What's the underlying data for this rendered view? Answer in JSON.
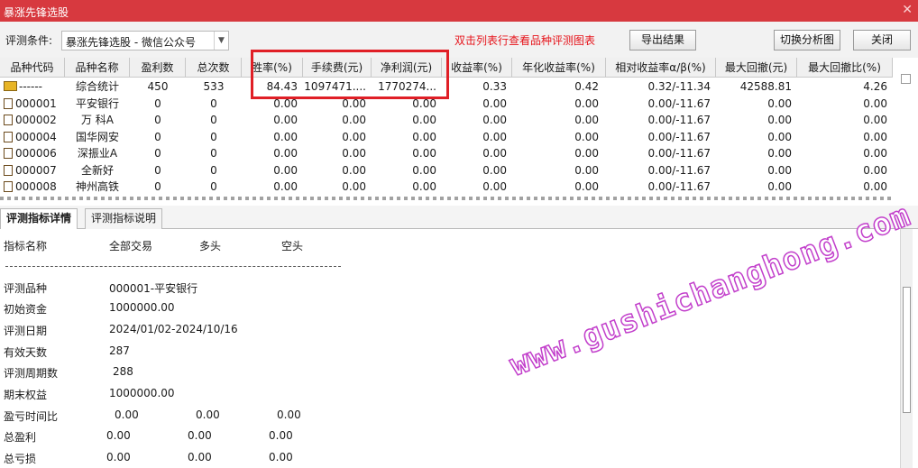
{
  "window": {
    "title": "暴涨先锋选股",
    "close_glyph": "✕"
  },
  "toolbar": {
    "condition_label": "评测条件:",
    "condition_value": "暴涨先锋选股  -  微信公众号",
    "hint": "双击列表行查看品种评测图表",
    "export_button": "导出结果",
    "switch_button": "切换分析图",
    "close_button": "关闭"
  },
  "grid": {
    "columns": [
      "品种代码",
      "品种名称",
      "盈利数",
      "总次数",
      "胜率(%)",
      "手续费(元)",
      "净利润(元)",
      "收益率(%)",
      "年化收益率(%)",
      "相对收益率α/β(%)",
      "最大回撤(元)",
      "最大回撤比(%)"
    ],
    "summary_row": {
      "code": "------",
      "name": "综合统计",
      "wins": "450",
      "total": "533",
      "win_rate": "84.43",
      "fee": "1097471....",
      "net_profit": "1770274...",
      "return": "0.33",
      "annual_return": "0.42",
      "relative": "0.32/-11.34",
      "max_dd": "42588.81",
      "max_dd_ratio": "4.26"
    },
    "rows": [
      {
        "code": "000001",
        "name": "平安银行",
        "wins": "0",
        "total": "0",
        "win_rate": "0.00",
        "fee": "0.00",
        "net_profit": "0.00",
        "return": "0.00",
        "annual_return": "0.00",
        "relative": "0.00/-11.67",
        "max_dd": "0.00",
        "max_dd_ratio": "0.00"
      },
      {
        "code": "000002",
        "name": "万 科A",
        "wins": "0",
        "total": "0",
        "win_rate": "0.00",
        "fee": "0.00",
        "net_profit": "0.00",
        "return": "0.00",
        "annual_return": "0.00",
        "relative": "0.00/-11.67",
        "max_dd": "0.00",
        "max_dd_ratio": "0.00"
      },
      {
        "code": "000004",
        "name": "国华网安",
        "wins": "0",
        "total": "0",
        "win_rate": "0.00",
        "fee": "0.00",
        "net_profit": "0.00",
        "return": "0.00",
        "annual_return": "0.00",
        "relative": "0.00/-11.67",
        "max_dd": "0.00",
        "max_dd_ratio": "0.00"
      },
      {
        "code": "000006",
        "name": "深振业A",
        "wins": "0",
        "total": "0",
        "win_rate": "0.00",
        "fee": "0.00",
        "net_profit": "0.00",
        "return": "0.00",
        "annual_return": "0.00",
        "relative": "0.00/-11.67",
        "max_dd": "0.00",
        "max_dd_ratio": "0.00"
      },
      {
        "code": "000007",
        "name": "全新好",
        "wins": "0",
        "total": "0",
        "win_rate": "0.00",
        "fee": "0.00",
        "net_profit": "0.00",
        "return": "0.00",
        "annual_return": "0.00",
        "relative": "0.00/-11.67",
        "max_dd": "0.00",
        "max_dd_ratio": "0.00"
      },
      {
        "code": "000008",
        "name": "神州高铁",
        "wins": "0",
        "total": "0",
        "win_rate": "0.00",
        "fee": "0.00",
        "net_profit": "0.00",
        "return": "0.00",
        "annual_return": "0.00",
        "relative": "0.00/-11.67",
        "max_dd": "0.00",
        "max_dd_ratio": "0.00"
      }
    ]
  },
  "tabs": [
    "评测指标详情",
    "评测指标说明"
  ],
  "detail": {
    "headers": [
      "指标名称",
      "全部交易",
      "多头",
      "空头"
    ],
    "items": [
      {
        "label": "评测品种",
        "values": [
          "000001-平安银行"
        ]
      },
      {
        "label": "初始资金",
        "values": [
          "1000000.00"
        ]
      },
      {
        "label": "评测日期",
        "values": [
          "2024/01/02-2024/10/16"
        ]
      },
      {
        "label": "有效天数",
        "values": [
          "287"
        ]
      },
      {
        "label": "评测周期数",
        "values": [
          "288"
        ]
      },
      {
        "label": "期末权益",
        "values": [
          "1000000.00"
        ]
      },
      {
        "label": "盈亏时间比",
        "values": [
          "0.00",
          "0.00",
          "0.00"
        ]
      },
      {
        "label": "总盈利",
        "values": [
          "0.00",
          "0.00",
          "0.00"
        ]
      },
      {
        "label": "总亏损",
        "values": [
          "0.00",
          "0.00",
          "0.00"
        ]
      }
    ]
  },
  "watermark": "www.gushichanghong.com",
  "colors": {
    "titlebar": "#d7393f",
    "hint": "#e6141b",
    "highlight_box": "#e01f26",
    "watermark_stroke": "#c23fcb"
  }
}
